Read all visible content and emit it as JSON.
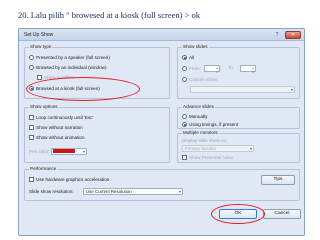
{
  "slide": {
    "title": "20. Lalu pilih \" browesed at a kiosk (full screen) > ok"
  },
  "dialog": {
    "title": "Set Up Show",
    "help": "?",
    "close": "✕",
    "show_type": {
      "label": "Show type",
      "options": [
        {
          "label": "Presented by a speaker (full screen)",
          "selected": false
        },
        {
          "label": "Browsed by an individual (window)",
          "selected": false
        },
        {
          "label": "Show scrollbar",
          "checked": false
        },
        {
          "label": "Browsed at a kiosk (full screen)",
          "selected": true
        }
      ]
    },
    "show_slides": {
      "label": "Show slides",
      "all": "All",
      "from": "From:",
      "to": "To:",
      "custom": "Custom show:"
    },
    "show_options": {
      "label": "Show options",
      "loop": "Loop continuously until 'Esc'",
      "no_narration": "Show without narration",
      "no_animation": "Show without animation",
      "pen_color": "Pen color:"
    },
    "advance_slides": {
      "label": "Advance slides",
      "manually": "Manually",
      "timings": "Using timings, if present"
    },
    "multiple_monitors": {
      "label": "Multiple monitors",
      "display_on": "Display slide show on:",
      "monitor_value": "Primary Monitor",
      "presenter_view": "Show Presenter View"
    },
    "performance": {
      "label": "Performance",
      "hw_accel": "Use hardware graphics acceleration",
      "tips": "Tips",
      "resolution_label": "Slide show resolution:",
      "resolution_value": "Use Current Resolution"
    },
    "ok": "OK",
    "cancel": "Cancel"
  },
  "colors": {
    "highlight": "#e3202a",
    "pen": "#d51212",
    "title_text": "#1c2f63"
  }
}
